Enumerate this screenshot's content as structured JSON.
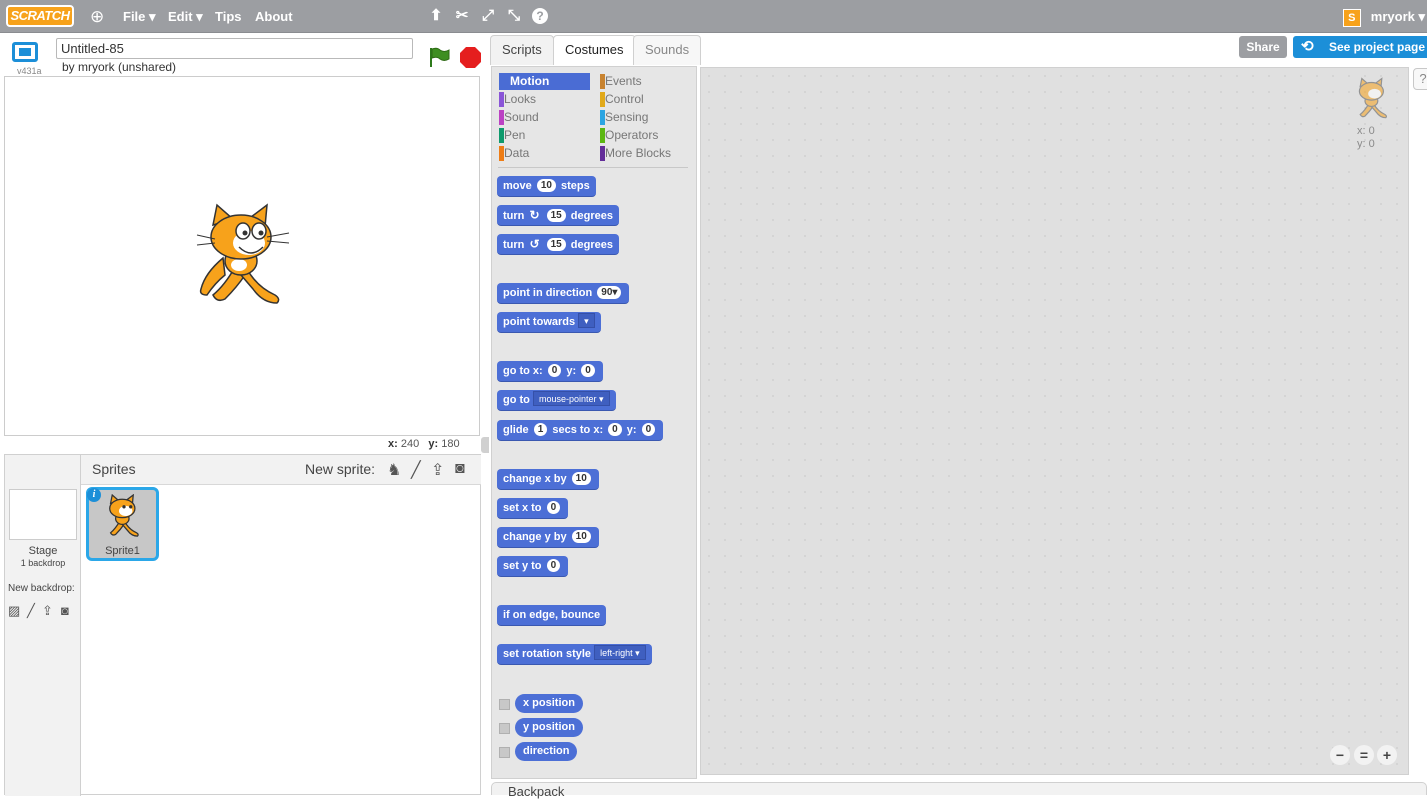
{
  "topbar": {
    "logo": "SCRATCH",
    "menus": [
      "File ▾",
      "Edit ▾",
      "Tips",
      "About"
    ],
    "tools": [
      "duplicate-icon",
      "cut-icon",
      "grow-icon",
      "shrink-icon",
      "help-icon"
    ],
    "user": "mryork ▾"
  },
  "stage_header": {
    "version": "v431a",
    "title": "Untitled-85",
    "byline": "by mryork (unshared)"
  },
  "stage_coords": {
    "x_label": "x:",
    "x": "240",
    "y_label": "y:",
    "y": "180"
  },
  "sprites": {
    "header": "Sprites",
    "new_sprite": "New sprite:",
    "stage_label": "Stage",
    "stage_backdrops": "1 backdrop",
    "new_backdrop": "New backdrop:",
    "items": [
      {
        "name": "Sprite1",
        "selected": true
      }
    ]
  },
  "tabs": [
    "Scripts",
    "Costumes",
    "Sounds"
  ],
  "actions": {
    "share": "Share",
    "see_project": "See project page"
  },
  "categories": [
    {
      "name": "Motion",
      "color": "#4a6cd4",
      "selected": true
    },
    {
      "name": "Events",
      "color": "#c88330"
    },
    {
      "name": "Looks",
      "color": "#8a55d7"
    },
    {
      "name": "Control",
      "color": "#e1a91a"
    },
    {
      "name": "Sound",
      "color": "#bb42c3"
    },
    {
      "name": "Sensing",
      "color": "#2ca5e2"
    },
    {
      "name": "Pen",
      "color": "#0e9a6c"
    },
    {
      "name": "Operators",
      "color": "#5cb712"
    },
    {
      "name": "Data",
      "color": "#ee7d16"
    },
    {
      "name": "More Blocks",
      "color": "#632d99"
    }
  ],
  "blocks": {
    "move": {
      "a": "move",
      "n": "10",
      "b": "steps"
    },
    "turn_right": {
      "a": "turn",
      "n": "15",
      "b": "degrees"
    },
    "turn_left": {
      "a": "turn",
      "n": "15",
      "b": "degrees"
    },
    "point_direction": {
      "a": "point in direction",
      "n": "90▾"
    },
    "point_towards": {
      "a": "point towards"
    },
    "goto_xy": {
      "a": "go to x:",
      "x": "0",
      "b": "y:",
      "y": "0"
    },
    "goto": {
      "a": "go to",
      "dd": "mouse-pointer ▾"
    },
    "glide": {
      "a": "glide",
      "n": "1",
      "b": "secs to x:",
      "x": "0",
      "c": "y:",
      "y": "0"
    },
    "change_x": {
      "a": "change x by",
      "n": "10"
    },
    "set_x": {
      "a": "set x to",
      "n": "0"
    },
    "change_y": {
      "a": "change y by",
      "n": "10"
    },
    "set_y": {
      "a": "set y to",
      "n": "0"
    },
    "bounce": {
      "a": "if on edge, bounce"
    },
    "rotation": {
      "a": "set rotation style",
      "dd": "left-right ▾"
    },
    "reporters": [
      "x position",
      "y position",
      "direction"
    ]
  },
  "script_area": {
    "sprite_x": "x: 0",
    "sprite_y": "y: 0"
  },
  "backpack": "Backpack"
}
